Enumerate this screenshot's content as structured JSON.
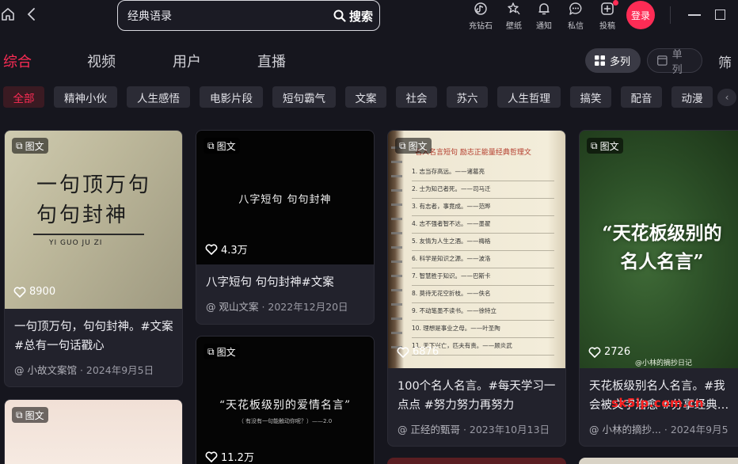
{
  "search": {
    "value": "经典语录",
    "button_label": "搜索"
  },
  "topnav": [
    {
      "name": "charge-icon",
      "label": "充钻石"
    },
    {
      "name": "wallpaper-icon",
      "label": "壁纸"
    },
    {
      "name": "bell-icon",
      "label": "通知"
    },
    {
      "name": "message-icon",
      "label": "私信"
    },
    {
      "name": "upload-icon",
      "label": "投稿"
    }
  ],
  "login_label": "登录",
  "tabs": [
    "综合",
    "视频",
    "用户",
    "直播"
  ],
  "view_modes": {
    "grid": "多列",
    "single": "单列"
  },
  "filter_label": "筛",
  "categories": [
    "全部",
    "精神小伙",
    "人生感悟",
    "电影片段",
    "短句霸气",
    "文案",
    "社会",
    "苏六",
    "人生哲理",
    "搞笑",
    "配音",
    "动漫"
  ],
  "badge_label": "图文",
  "cards": [
    {
      "likes": "8900",
      "cover_lines": [
        "一句顶万句",
        "句句封神"
      ],
      "cover_sub": "YI GUO JU ZI",
      "title": "一句顶万句，句句封神。#文案 #总有一句话戳心",
      "author": "@ 小故文案馆",
      "date": " · 2024年9月5日"
    },
    {
      "likes": "4.3万",
      "cover_lines": [
        "八字短句 句句封神"
      ],
      "title": "八字短句 句句封神#文案",
      "author": "@ 观山文案",
      "date": " · 2022年12月20日"
    },
    {
      "likes": "6876",
      "cover_heading": "名人名言短句 励志正能量经典哲理文",
      "cover_items": [
        "1. 志当存高远。——诸葛亮",
        "2. 士为知己者死。——司马迁",
        "3. 有志者，事竟成。——范晔",
        "4. 志不强者智不达。——墨翟",
        "5. 友情为人生之酒。——梅格",
        "6. 科学是知识之源。——波洛",
        "7. 智慧胜于知识。——巴斯卡",
        "8. 莫待无花空折枝。——佚名",
        "9. 不动笔墨不读书。——徐特立",
        "10. 理想是事业之母。——叶圣陶",
        "11. 天下兴亡，匹夫有责。——顾炎武"
      ],
      "title": "100个名人名言。#每天学习一点点 #努力努力再努力",
      "author": "@ 正经的甄哥",
      "date": " · 2023年10月13日"
    },
    {
      "likes": "2726",
      "cover_lines": [
        "“天花板级别的",
        "名人名言”"
      ],
      "cover_sub": "@小林的摘抄日记",
      "title": "天花板级别名人名言。#我会被文字治愈 #分享经典…",
      "author": "@ 小林的摘抄...",
      "date": " · 2024年9月5"
    },
    {
      "likes": "11.2万",
      "cover_lines": [
        "“天花板级别的爱情名言”"
      ],
      "cover_sub": "（ 有没有一句能触动你呢？）——2.0"
    },
    {}
  ],
  "watermark": "sk5ip.com.cn",
  "colors": {
    "accent": "#fe2c55",
    "background": "#16161e",
    "card": "#22222c",
    "chip": "#2b2b35"
  }
}
